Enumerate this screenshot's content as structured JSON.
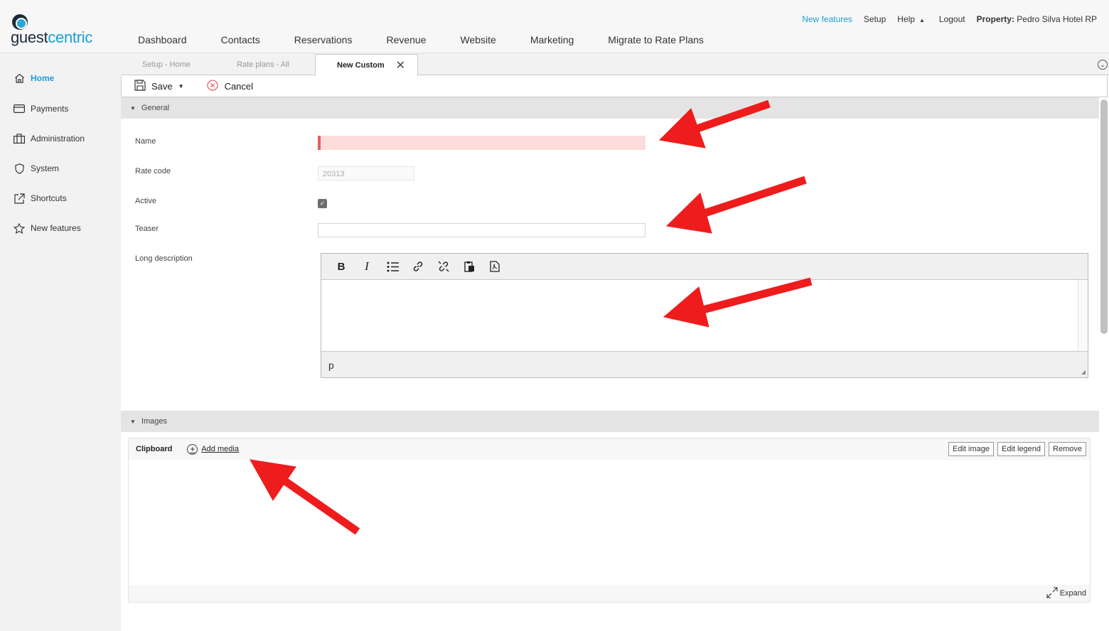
{
  "brand": {
    "part1": "guest",
    "part2": "centric"
  },
  "topnav": [
    {
      "label": "Dashboard"
    },
    {
      "label": "Contacts"
    },
    {
      "label": "Reservations"
    },
    {
      "label": "Revenue"
    },
    {
      "label": "Website"
    },
    {
      "label": "Marketing"
    },
    {
      "label": "Migrate to Rate Plans"
    }
  ],
  "toplinks": {
    "new_features": "New features",
    "setup": "Setup",
    "help": "Help",
    "logout": "Logout",
    "property_label": "Property:",
    "property_value": "Pedro Silva Hotel RP"
  },
  "sidebar": [
    {
      "label": "Home",
      "icon": "home-icon"
    },
    {
      "label": "Payments",
      "icon": "card-icon"
    },
    {
      "label": "Administration",
      "icon": "building-icon"
    },
    {
      "label": "System",
      "icon": "shield-icon"
    },
    {
      "label": "Shortcuts",
      "icon": "external-link-icon"
    },
    {
      "label": "New features",
      "icon": "star-icon"
    }
  ],
  "tabs": [
    {
      "label": "Setup - Home"
    },
    {
      "label": "Rate plans - All"
    },
    {
      "label": "New Custom"
    }
  ],
  "toolbar": {
    "save": "Save",
    "cancel": "Cancel"
  },
  "sections": {
    "general": "General",
    "images": "Images"
  },
  "form": {
    "name_label": "Name",
    "name_value": "",
    "rate_code_label": "Rate code",
    "rate_code_value": "20313",
    "active_label": "Active",
    "active_checked": true,
    "teaser_label": "Teaser",
    "teaser_value": "",
    "long_desc_label": "Long description"
  },
  "editor": {
    "tools": [
      "bold-icon",
      "italic-icon",
      "bullet-list-icon",
      "link-icon",
      "unlink-icon",
      "paste-icon",
      "pdf-icon"
    ],
    "status": "p"
  },
  "images": {
    "clipboard": "Clipboard",
    "add_media": "Add media",
    "edit_image": "Edit image",
    "edit_legend": "Edit legend",
    "remove": "Remove",
    "expand": "Expand"
  },
  "colors": {
    "accent": "#1a9ed4",
    "arrow": "#ee1c1c",
    "name_error_bg": "#fddcdc"
  }
}
